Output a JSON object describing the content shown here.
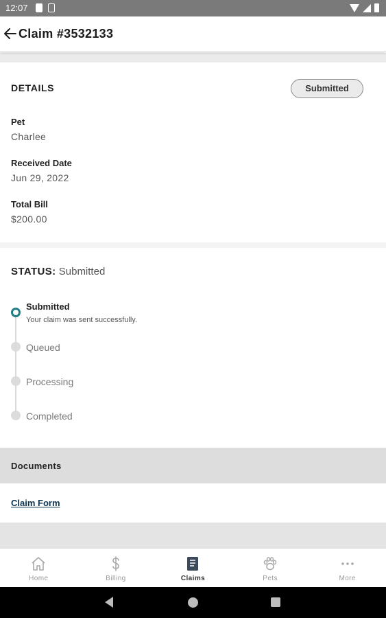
{
  "status_bar": {
    "time": "12:07"
  },
  "header": {
    "title": "Claim #3532133"
  },
  "details": {
    "heading": "DETAILS",
    "badge": "Submitted",
    "fields": [
      {
        "label": "Pet",
        "value": "Charlee"
      },
      {
        "label": "Received Date",
        "value": "Jun 29, 2022"
      },
      {
        "label": "Total Bill",
        "value": "$200.00"
      }
    ]
  },
  "status": {
    "label": "STATUS:",
    "value": "Submitted",
    "steps": [
      {
        "label": "Submitted",
        "description": "Your claim was sent successfully.",
        "active": true
      },
      {
        "label": "Queued",
        "active": false
      },
      {
        "label": "Processing",
        "active": false
      },
      {
        "label": "Completed",
        "active": false
      }
    ]
  },
  "documents": {
    "heading": "Documents",
    "link": "Claim Form"
  },
  "bottom_nav": {
    "items": [
      {
        "label": "Home",
        "icon": "home-icon",
        "active": false
      },
      {
        "label": "Billing",
        "icon": "dollar-icon",
        "active": false
      },
      {
        "label": "Claims",
        "icon": "document-icon",
        "active": true
      },
      {
        "label": "Pets",
        "icon": "paw-icon",
        "active": false
      },
      {
        "label": "More",
        "icon": "more-dots-icon",
        "active": false
      }
    ]
  },
  "colors": {
    "accent_teal": "#1f7d86",
    "link_navy": "#0b3350",
    "status_bar": "#7a7a7a"
  }
}
